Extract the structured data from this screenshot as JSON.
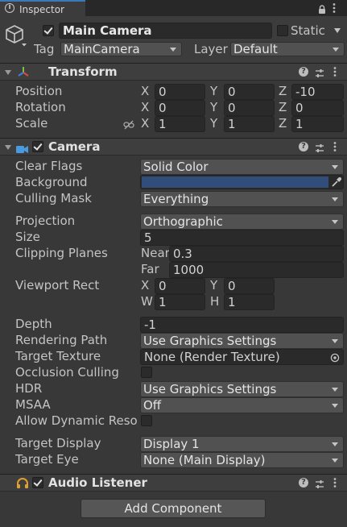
{
  "window": {
    "tab_title": "Inspector"
  },
  "object": {
    "name": "Main Camera",
    "static_label": "Static",
    "tag_label": "Tag",
    "tag_value": "MainCamera",
    "layer_label": "Layer",
    "layer_value": "Default"
  },
  "transform": {
    "title": "Transform",
    "position_label": "Position",
    "rotation_label": "Rotation",
    "scale_label": "Scale",
    "axis": {
      "x": "X",
      "y": "Y",
      "z": "Z"
    },
    "position": {
      "x": "0",
      "y": "0",
      "z": "-10"
    },
    "rotation": {
      "x": "0",
      "y": "0",
      "z": "0"
    },
    "scale": {
      "x": "1",
      "y": "1",
      "z": "1"
    }
  },
  "camera": {
    "title": "Camera",
    "clear_flags_label": "Clear Flags",
    "clear_flags_value": "Solid Color",
    "background_label": "Background",
    "background_color": "#314d79",
    "culling_mask_label": "Culling Mask",
    "culling_mask_value": "Everything",
    "projection_label": "Projection",
    "projection_value": "Orthographic",
    "size_label": "Size",
    "size_value": "5",
    "clipping_label": "Clipping Planes",
    "near_label": "Near",
    "near_value": "0.3",
    "far_label": "Far",
    "far_value": "1000",
    "viewport_label": "Viewport Rect",
    "viewport": {
      "x_label": "X",
      "x": "0",
      "y_label": "Y",
      "y": "0",
      "w_label": "W",
      "w": "1",
      "h_label": "H",
      "h": "1"
    },
    "depth_label": "Depth",
    "depth_value": "-1",
    "rendering_path_label": "Rendering Path",
    "rendering_path_value": "Use Graphics Settings",
    "target_texture_label": "Target Texture",
    "target_texture_value": "None (Render Texture)",
    "occlusion_label": "Occlusion Culling",
    "hdr_label": "HDR",
    "hdr_value": "Use Graphics Settings",
    "msaa_label": "MSAA",
    "msaa_value": "Off",
    "dynamic_res_label": "Allow Dynamic Reso",
    "target_display_label": "Target Display",
    "target_display_value": "Display 1",
    "target_eye_label": "Target Eye",
    "target_eye_value": "None (Main Display)"
  },
  "audio_listener": {
    "title": "Audio Listener"
  },
  "add_component_label": "Add Component",
  "colors": {
    "accent": "#3a79bb",
    "panel": "#383838",
    "header": "#3e3e3e",
    "field": "#2a2a2a"
  },
  "icons": [
    "info-icon",
    "lock-icon",
    "kebab-menu-icon",
    "gameobject-cube-icon",
    "transform-axes-icon",
    "camera-icon",
    "audio-listener-icon",
    "help-icon",
    "presets-icon",
    "color-picker-icon",
    "object-picker-icon",
    "link-scale-icon"
  ]
}
